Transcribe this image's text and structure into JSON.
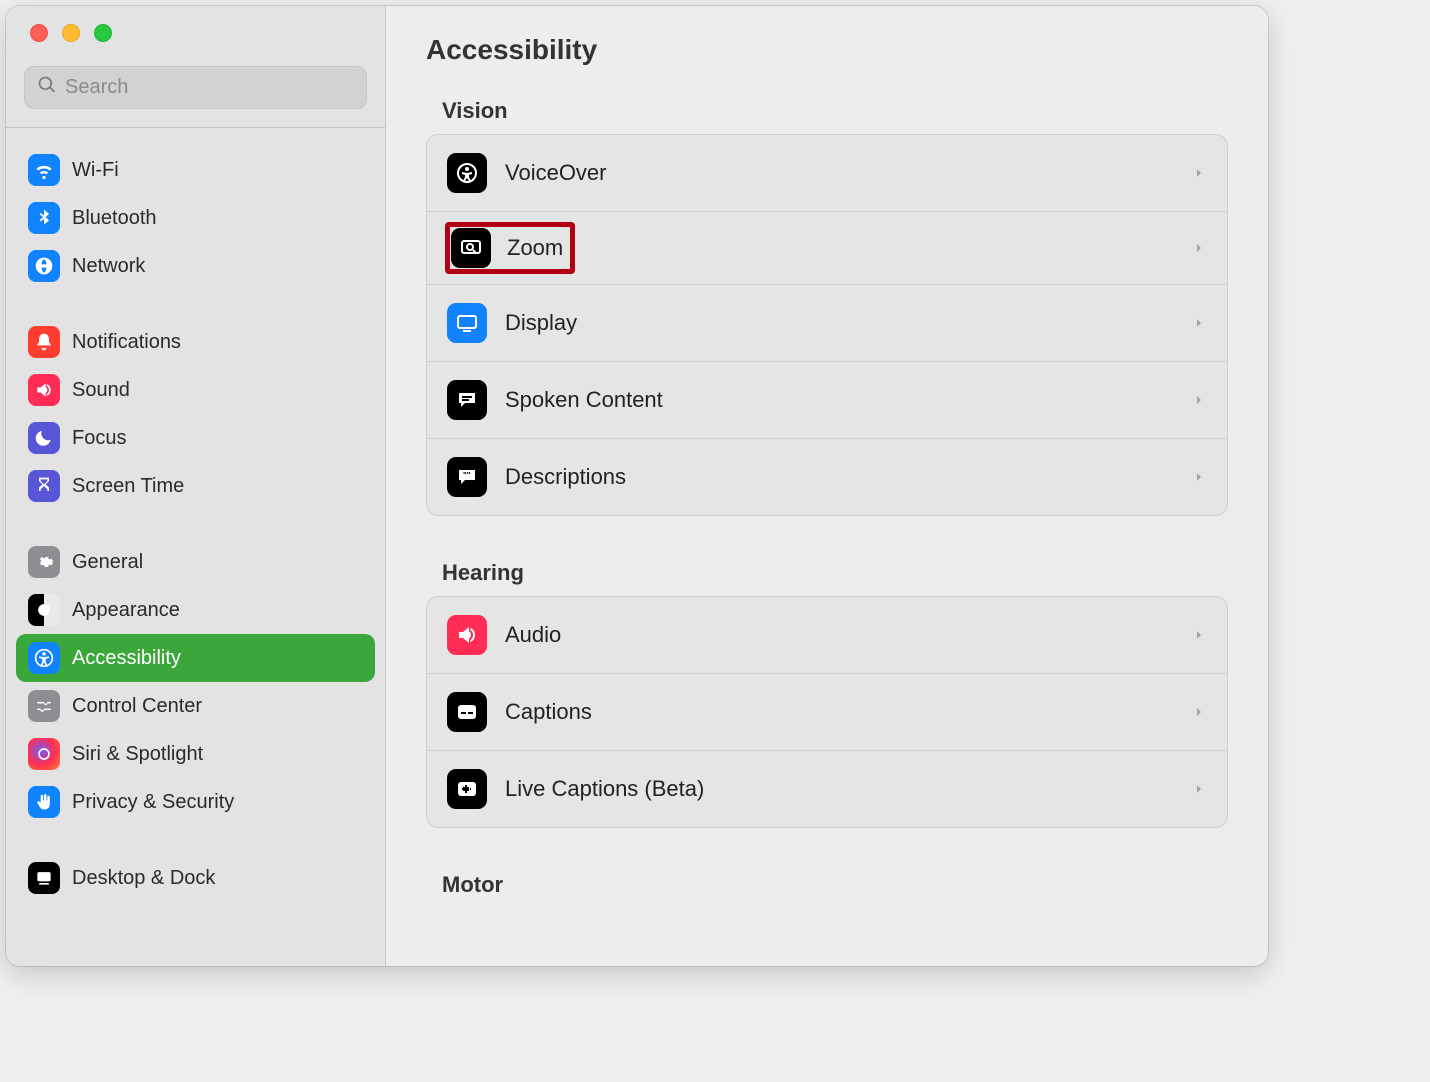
{
  "search": {
    "placeholder": "Search"
  },
  "sidebar": {
    "groups": [
      [
        {
          "id": "wifi",
          "label": "Wi-Fi"
        },
        {
          "id": "bluetooth",
          "label": "Bluetooth"
        },
        {
          "id": "network",
          "label": "Network"
        }
      ],
      [
        {
          "id": "notifications",
          "label": "Notifications"
        },
        {
          "id": "sound",
          "label": "Sound"
        },
        {
          "id": "focus",
          "label": "Focus"
        },
        {
          "id": "screen-time",
          "label": "Screen Time"
        }
      ],
      [
        {
          "id": "general",
          "label": "General"
        },
        {
          "id": "appearance",
          "label": "Appearance"
        },
        {
          "id": "accessibility",
          "label": "Accessibility",
          "active": true
        },
        {
          "id": "control-center",
          "label": "Control Center"
        },
        {
          "id": "siri-spotlight",
          "label": "Siri & Spotlight"
        },
        {
          "id": "privacy-security",
          "label": "Privacy & Security"
        }
      ],
      [
        {
          "id": "desktop-dock",
          "label": "Desktop & Dock"
        }
      ]
    ]
  },
  "main": {
    "title": "Accessibility",
    "sections": [
      {
        "id": "vision",
        "label": "Vision",
        "items": [
          {
            "id": "voiceover",
            "label": "VoiceOver"
          },
          {
            "id": "zoom",
            "label": "Zoom",
            "highlighted": true
          },
          {
            "id": "display",
            "label": "Display"
          },
          {
            "id": "spoken-content",
            "label": "Spoken Content"
          },
          {
            "id": "descriptions",
            "label": "Descriptions"
          }
        ]
      },
      {
        "id": "hearing",
        "label": "Hearing",
        "items": [
          {
            "id": "audio",
            "label": "Audio"
          },
          {
            "id": "captions",
            "label": "Captions"
          },
          {
            "id": "live-captions",
            "label": "Live Captions (Beta)"
          }
        ]
      },
      {
        "id": "motor",
        "label": "Motor",
        "items": []
      }
    ]
  }
}
